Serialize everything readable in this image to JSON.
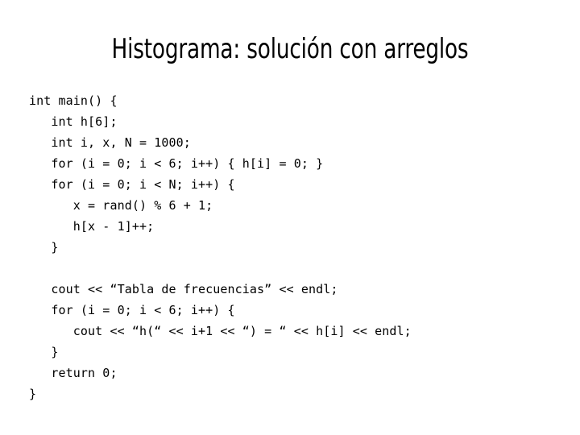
{
  "slide": {
    "title": "Histograma: solución con arreglos",
    "background_color": "#ffffff",
    "text_color": "#000000"
  },
  "code": {
    "language": "C++",
    "lines": [
      "int main() {",
      "   int h[6];",
      "   int i, x, N = 1000;",
      "   for (i = 0; i < 6; i++) { h[i] = 0; }",
      "   for (i = 0; i < N; i++) {",
      "      x = rand() % 6 + 1;",
      "      h[x - 1]++;",
      "   }",
      "",
      "   cout << “Tabla de frecuencias” << endl;",
      "   for (i = 0; i < 6; i++) {",
      "      cout << “h(“ << i+1 << “) = “ << h[i] << endl;",
      "   }",
      "   return 0;",
      "}"
    ]
  }
}
